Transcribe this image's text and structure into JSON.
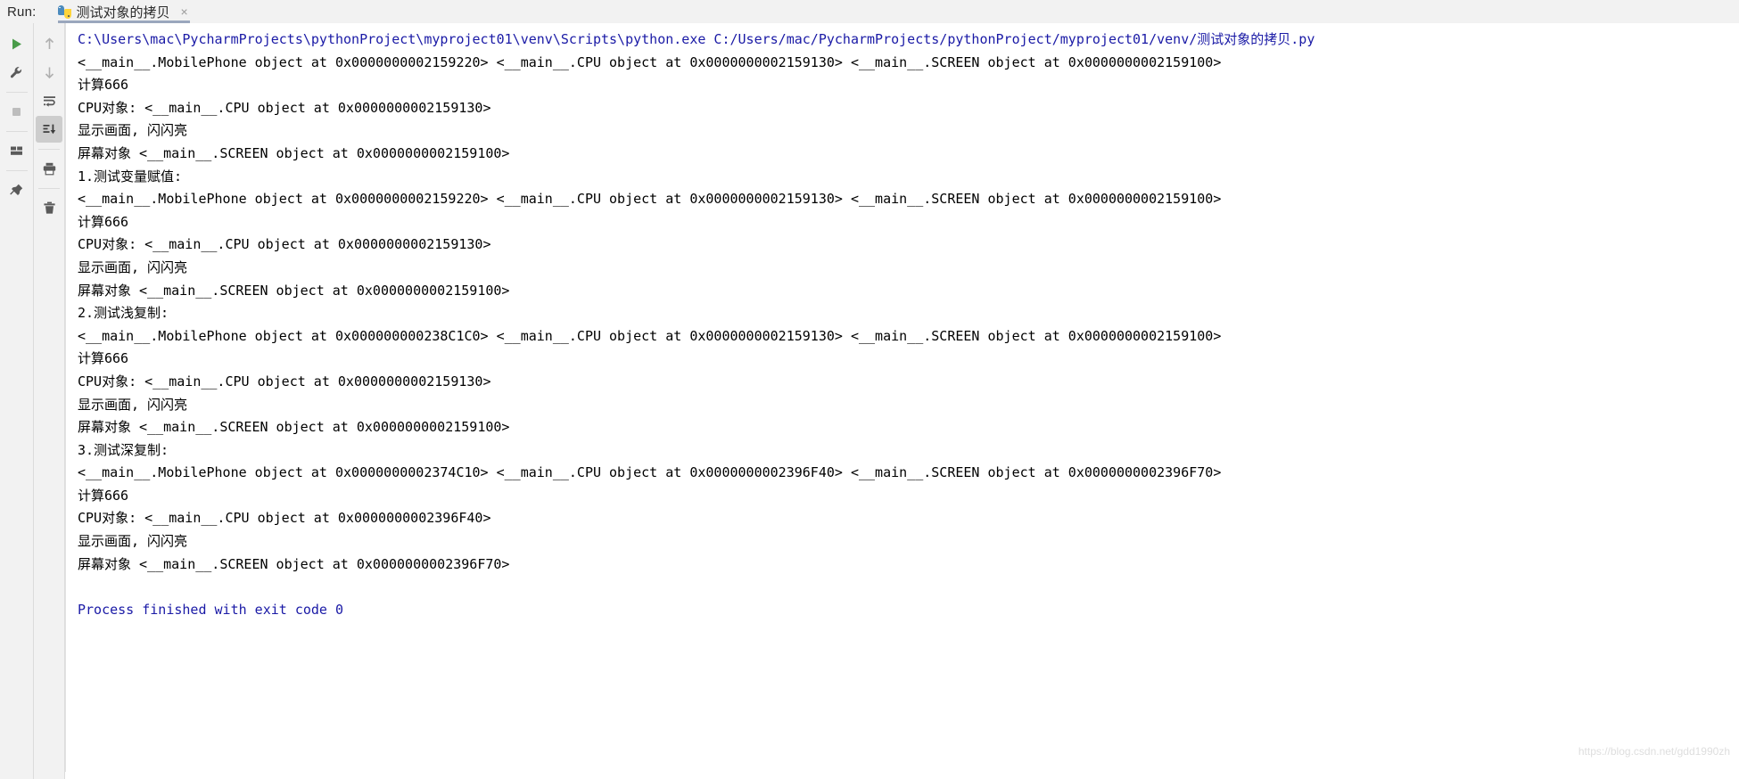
{
  "header": {
    "run_label": "Run:",
    "tab": {
      "icon": "python-icon",
      "title": "测试对象的拷贝",
      "close": "×"
    }
  },
  "toolbar_left": {
    "items": [
      {
        "name": "rerun-button",
        "icon": "play-icon",
        "label": "Rerun"
      },
      {
        "name": "edit-configurations-button",
        "icon": "wrench-icon",
        "label": "Edit Configurations"
      },
      {
        "name": "stop-button",
        "icon": "stop-square-icon",
        "label": "Stop"
      },
      {
        "name": "restore-layout-button",
        "icon": "layout-icon",
        "label": "Restore Layout"
      },
      {
        "name": "pin-tab-button",
        "icon": "pin-icon",
        "label": "Pin Tab"
      }
    ]
  },
  "toolbar_right": {
    "items": [
      {
        "name": "up-the-stack-button",
        "icon": "arrow-up-icon",
        "label": "Up the Stack Trace"
      },
      {
        "name": "down-the-stack-button",
        "icon": "arrow-down-icon",
        "label": "Down the Stack Trace"
      },
      {
        "name": "soft-wrap-button",
        "icon": "soft-wrap-icon",
        "label": "Soft-Wrap"
      },
      {
        "name": "scroll-to-end-button",
        "icon": "scroll-to-end-icon",
        "label": "Scroll to End",
        "selected": true
      },
      {
        "name": "print-button",
        "icon": "printer-icon",
        "label": "Print"
      },
      {
        "name": "clear-all-button",
        "icon": "trash-icon",
        "label": "Clear All"
      }
    ]
  },
  "console": {
    "lines": [
      {
        "text": "C:\\Users\\mac\\PycharmProjects\\pythonProject\\myproject01\\venv\\Scripts\\python.exe C:/Users/mac/PycharmProjects/pythonProject/myproject01/venv/测试对象的拷贝.py",
        "style": "cmd"
      },
      {
        "text": "<__main__.MobilePhone object at 0x0000000002159220> <__main__.CPU object at 0x0000000002159130> <__main__.SCREEN object at 0x0000000002159100>",
        "style": "out"
      },
      {
        "text": "计算666",
        "style": "out"
      },
      {
        "text": "CPU对象: <__main__.CPU object at 0x0000000002159130>",
        "style": "out"
      },
      {
        "text": "显示画面, 闪闪亮",
        "style": "out"
      },
      {
        "text": "屏幕对象 <__main__.SCREEN object at 0x0000000002159100>",
        "style": "out"
      },
      {
        "text": "1.测试变量赋值:",
        "style": "out"
      },
      {
        "text": "<__main__.MobilePhone object at 0x0000000002159220> <__main__.CPU object at 0x0000000002159130> <__main__.SCREEN object at 0x0000000002159100>",
        "style": "out"
      },
      {
        "text": "计算666",
        "style": "out"
      },
      {
        "text": "CPU对象: <__main__.CPU object at 0x0000000002159130>",
        "style": "out"
      },
      {
        "text": "显示画面, 闪闪亮",
        "style": "out"
      },
      {
        "text": "屏幕对象 <__main__.SCREEN object at 0x0000000002159100>",
        "style": "out"
      },
      {
        "text": "2.测试浅复制:",
        "style": "out"
      },
      {
        "text": "<__main__.MobilePhone object at 0x000000000238C1C0> <__main__.CPU object at 0x0000000002159130> <__main__.SCREEN object at 0x0000000002159100>",
        "style": "out"
      },
      {
        "text": "计算666",
        "style": "out"
      },
      {
        "text": "CPU对象: <__main__.CPU object at 0x0000000002159130>",
        "style": "out"
      },
      {
        "text": "显示画面, 闪闪亮",
        "style": "out"
      },
      {
        "text": "屏幕对象 <__main__.SCREEN object at 0x0000000002159100>",
        "style": "out"
      },
      {
        "text": "3.测试深复制:",
        "style": "out"
      },
      {
        "text": "<__main__.MobilePhone object at 0x0000000002374C10> <__main__.CPU object at 0x0000000002396F40> <__main__.SCREEN object at 0x0000000002396F70>",
        "style": "out"
      },
      {
        "text": "计算666",
        "style": "out"
      },
      {
        "text": "CPU对象: <__main__.CPU object at 0x0000000002396F40>",
        "style": "out"
      },
      {
        "text": "显示画面, 闪闪亮",
        "style": "out"
      },
      {
        "text": "屏幕对象 <__main__.SCREEN object at 0x0000000002396F70>",
        "style": "out"
      },
      {
        "text": " ",
        "style": "blank"
      },
      {
        "text": "Process finished with exit code 0",
        "style": "fin"
      }
    ]
  },
  "watermark": "https://blog.csdn.net/gdd1990zh",
  "colors": {
    "command_text": "#1a1aa6",
    "output_text": "#000000",
    "toolbar_bg": "#f2f2f2",
    "tab_underline": "#9aa7bd",
    "run_icon_green": "#4a9c4a"
  }
}
